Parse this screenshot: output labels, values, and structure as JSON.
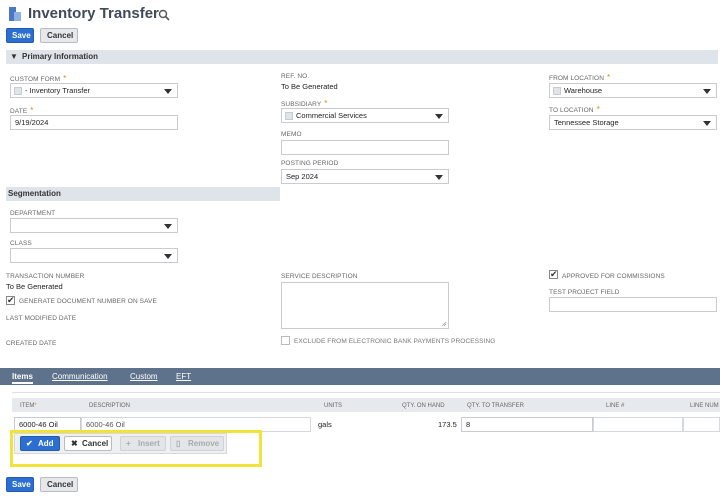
{
  "header": {
    "title": "Inventory Transfer"
  },
  "toolbar": {
    "save_label": "Save",
    "cancel_label": "Cancel"
  },
  "primary": {
    "section_title": "Primary Information",
    "custom_form": {
      "label": "CUSTOM FORM",
      "value": "- Inventory Transfer"
    },
    "date": {
      "label": "DATE",
      "value": "9/19/2024"
    },
    "ref_no": {
      "label": "REF. NO.",
      "value": "To Be Generated"
    },
    "subsidiary": {
      "label": "SUBSIDIARY",
      "value": "Commercial Services"
    },
    "memo": {
      "label": "MEMO",
      "value": ""
    },
    "posting_period": {
      "label": "POSTING PERIOD",
      "value": "Sep 2024"
    },
    "from_location": {
      "label": "FROM LOCATION",
      "value": "Warehouse"
    },
    "to_location": {
      "label": "TO LOCATION",
      "value": "Tennessee Storage"
    }
  },
  "segmentation": {
    "section_title": "Segmentation",
    "department": {
      "label": "DEPARTMENT",
      "value": ""
    },
    "class": {
      "label": "CLASS",
      "value": ""
    }
  },
  "details": {
    "transaction_number_label": "TRANSACTION NUMBER",
    "transaction_number_value": "To Be Generated",
    "generate_label": "GENERATE DOCUMENT NUMBER ON SAVE",
    "last_modified_label": "LAST MODIFIED DATE",
    "created_label": "CREATED DATE",
    "service_desc_label": "SERVICE DESCRIPTION",
    "exclude_label": "EXCLUDE FROM ELECTRONIC BANK PAYMENTS PROCESSING",
    "approved_label": "APPROVED FOR COMMISSIONS",
    "test_project_label": "TEST PROJECT FIELD"
  },
  "tabs": [
    {
      "label": "Items"
    },
    {
      "label": "Communication"
    },
    {
      "label": "Custom"
    },
    {
      "label": "EFT"
    }
  ],
  "items_table": {
    "headers": [
      "ITEM",
      "DESCRIPTION",
      "UNITS",
      "QTY. ON HAND",
      "QTY. TO TRANSFER",
      "LINE #",
      "LINE NUM"
    ],
    "row": {
      "item": "6000-46 Oil",
      "description": "6000-46 Oil",
      "units": "gals",
      "qty_on_hand": "173.5",
      "qty_to_transfer": "8"
    }
  },
  "row_actions": {
    "add": "Add",
    "cancel": "Cancel",
    "insert": "Insert",
    "remove": "Remove"
  },
  "colors": {
    "primary_button": "#2c6fd1",
    "tab_bar": "#5f728c",
    "section_bar": "#dfe3ea",
    "highlight": "#f2e33a",
    "required_star": "#e08a00"
  }
}
